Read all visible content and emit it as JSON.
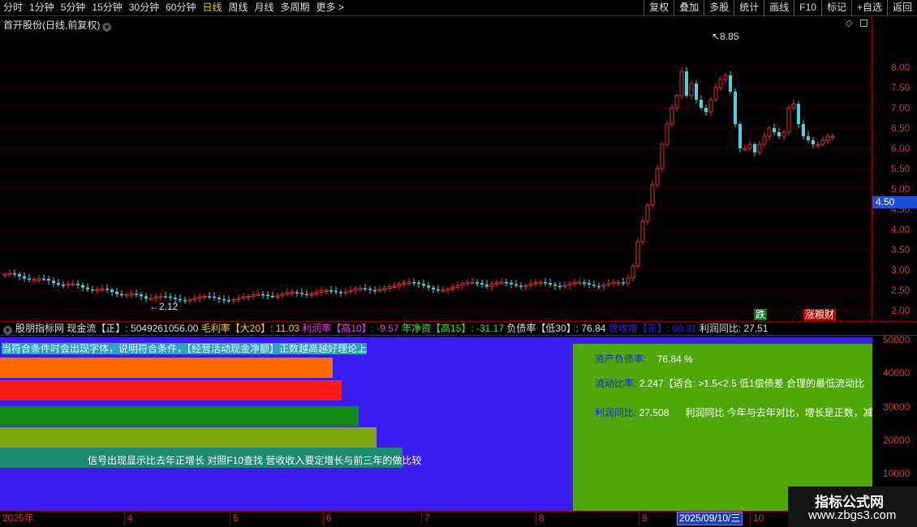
{
  "toolbar": {
    "periods": [
      "分时",
      "1分钟",
      "5分钟",
      "15分钟",
      "30分钟",
      "60分钟",
      "日线",
      "周线",
      "月线",
      "多周期",
      "更多 >"
    ],
    "active_period": "日线",
    "actions": [
      "复权",
      "叠加",
      "多股",
      "统计",
      "画线",
      "F10",
      "标记",
      "+自选",
      "返回"
    ]
  },
  "main_chart": {
    "title": "首开股份(日线,前复权)",
    "price_ticks": [
      "8.00",
      "7.50",
      "7.00",
      "6.50",
      "6.00",
      "5.50",
      "5.00",
      "4.50",
      "4.00",
      "3.50",
      "3.00",
      "2.50",
      "2.00"
    ],
    "current_price": "4.50",
    "high_label": "8.85",
    "low_label": "2.12",
    "tag_die": "跌",
    "tag_zhang": "涨粮财"
  },
  "indicator": {
    "parts": [
      {
        "text": "股朋指标网",
        "color": "#dddddd"
      },
      {
        "text": " 现金流【正】: 5049261056.00 ",
        "color": "#dddddd"
      },
      {
        "text": "毛利率【大20】: 11.03 ",
        "color": "#f6d000"
      },
      {
        "text": "利润率【高10】: -9.57 ",
        "color": "#e040fb"
      },
      {
        "text": "年净资【高15】: -31.17 ",
        "color": "#39e639"
      },
      {
        "text": "负债率【低30】: 76.84 ",
        "color": "#dddddd"
      },
      {
        "text": "营收增【正】: 60.31 ",
        "color": "#3a1cf3"
      },
      {
        "text": "利润同比: 27.51",
        "color": "#dddddd"
      }
    ],
    "condition_text": "当符合条件时会出现字体，说明符合条件，【经营活动现金净额】正数越高越好理论上",
    "teal_text": "信号出现显示比去年正增长    对照F10查找 营收收入要定增长与前三年的做比较",
    "bars": [
      {
        "color": "#ff6a00"
      },
      {
        "color": "#ff1a1a"
      },
      {
        "color": "#118a11"
      },
      {
        "color": "#7fa512"
      },
      {
        "color": "#1b8a6e"
      }
    ],
    "green_box": {
      "line1_label": "资产负债率:",
      "line1_value": "76.84 %",
      "line2_label": "流动比率:",
      "line2_value": "2.247【适合: >1.5<2.5 低1偿债差  合理的最低流动比",
      "line3_label": "利润同比:",
      "line3_value": "27.508",
      "line3_note": "利润同比 今年与去年对比，增长是正数，减少"
    },
    "vol_ticks": [
      "50000",
      "40000",
      "30000",
      "20000",
      "10000"
    ]
  },
  "date_axis": {
    "labels": [
      "2025年",
      "4",
      "5",
      "6",
      "7",
      "8",
      "9",
      "10"
    ],
    "cursor_date": "2025/09/10/三"
  },
  "watermark": {
    "line1": "指标公式网",
    "line2": "www.zbgs3.com"
  },
  "colors": {
    "up": "#e03030",
    "down": "#4dd0e1",
    "grid": "#8b0000",
    "panel_blue": "#3a1cf3",
    "panel_green": "#4ea80a"
  }
}
